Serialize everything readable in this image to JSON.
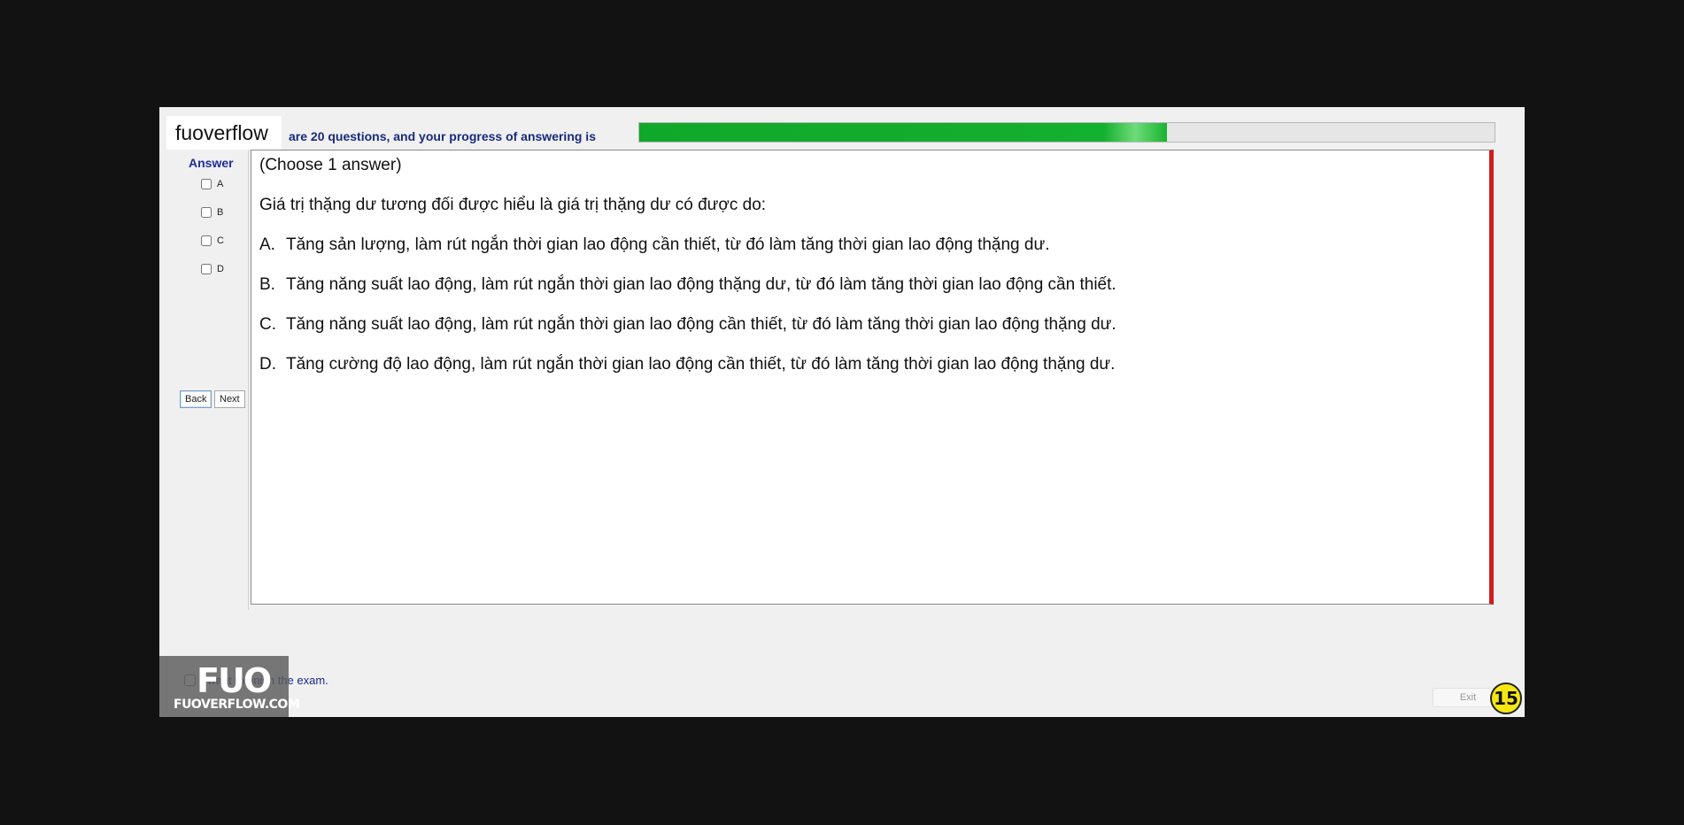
{
  "watermark": {
    "text": "fuoverflow"
  },
  "progress": {
    "label": "are 20 questions, and your progress of answering is",
    "fraction": 0.617,
    "color": "#14b02f"
  },
  "answer_panel": {
    "title": "Answer",
    "options": [
      "A",
      "B",
      "C",
      "D"
    ],
    "back_label": "Back",
    "next_label": "Next"
  },
  "question": {
    "instruction": "(Choose 1 answer)",
    "stem": "Giá trị thặng dư tương đối được hiểu là giá trị thặng dư có được do:",
    "choices": [
      {
        "label": "A.",
        "text": "Tăng sản lượng, làm rút ngắn thời gian lao động cần thiết, từ đó làm tăng thời gian lao động thặng dư."
      },
      {
        "label": "B.",
        "text": "Tăng năng suất lao động, làm rút ngắn thời gian lao động thặng dư, từ đó làm tăng thời gian lao động cần thiết."
      },
      {
        "label": "C.",
        "text": "Tăng năng suất lao động, làm rút ngắn thời gian lao động cần thiết, từ đó làm tăng thời gian lao động thặng dư."
      },
      {
        "label": "D.",
        "text": "Tăng cường độ lao động, làm rút ngắn thời gian lao động cần thiết, từ đó làm tăng thời gian lao động thặng dư."
      }
    ]
  },
  "footer": {
    "finish_text": "I want to finish the exam.",
    "exit_label": "Exit",
    "logo_main": "FUO",
    "logo_sub": "FUOVERFLOW.COM",
    "badge": "15"
  }
}
